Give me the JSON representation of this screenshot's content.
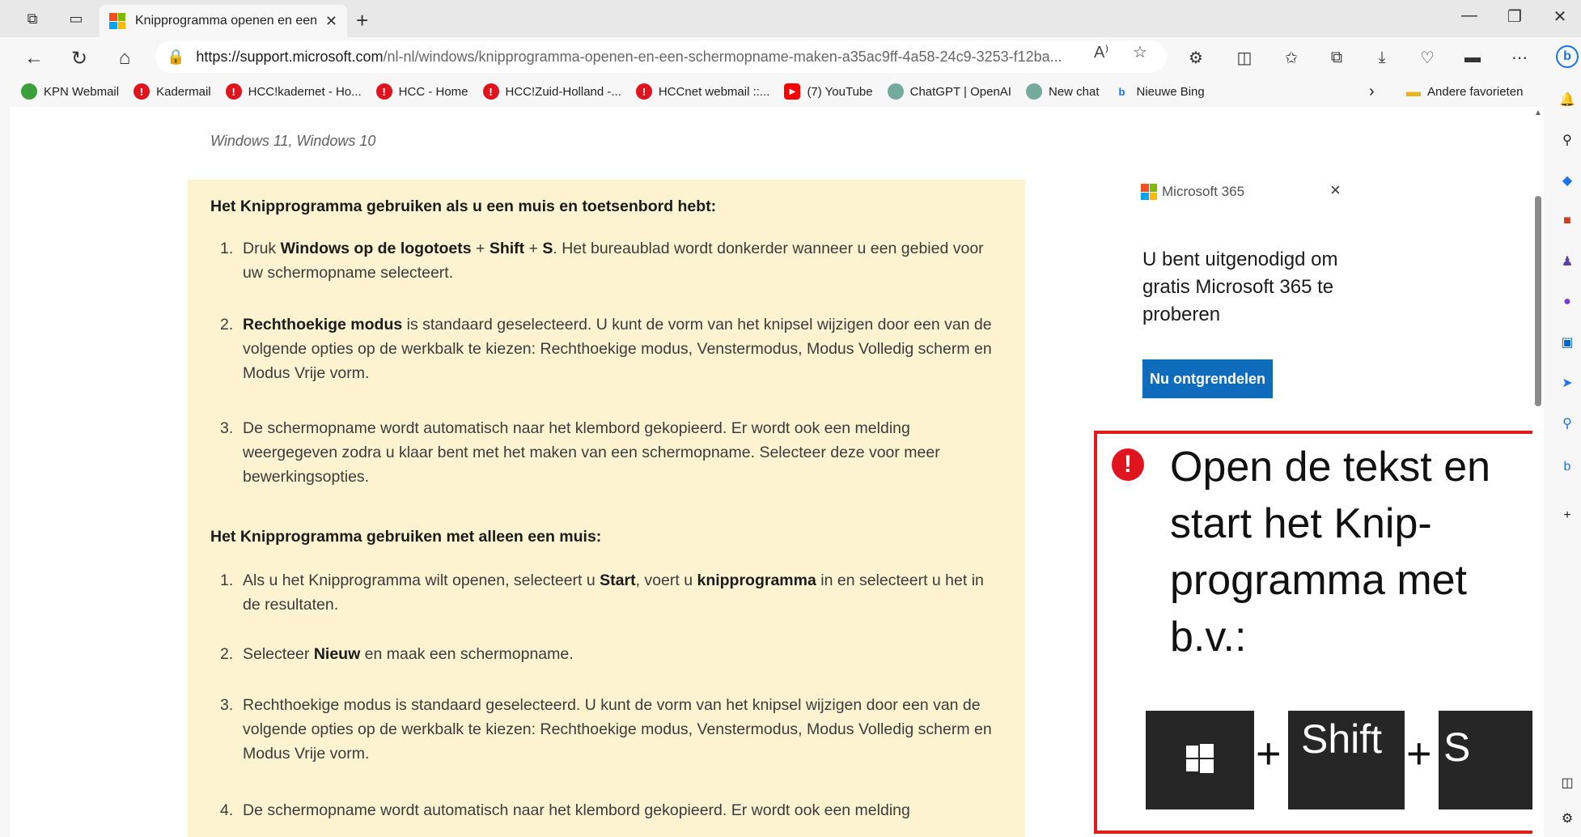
{
  "browser": {
    "tab_title": "Knipprogramma openen en een schermopname maken",
    "url_host": "https://support.microsoft.com",
    "url_rest": "/nl-nl/windows/knipprogramma-openen-en-een-schermopname-maken-a35ac9ff-4a58-24c9-3253-f12ba..."
  },
  "favorites": [
    {
      "label": "KPN Webmail",
      "icon": "kpn-icon",
      "color": "#3aa03a"
    },
    {
      "label": "Kadermail",
      "icon": "alert-icon",
      "color": "#e0141e"
    },
    {
      "label": "HCC!kadernet - Ho...",
      "icon": "alert-icon",
      "color": "#e0141e"
    },
    {
      "label": "HCC - Home",
      "icon": "alert-icon",
      "color": "#e0141e"
    },
    {
      "label": "HCC!Zuid-Holland -...",
      "icon": "alert-icon",
      "color": "#e0141e"
    },
    {
      "label": "HCCnet webmail ::...",
      "icon": "alert-icon",
      "color": "#e0141e"
    },
    {
      "label": "(7) YouTube",
      "icon": "youtube-icon",
      "color": "#ff0000"
    },
    {
      "label": "ChatGPT | OpenAI",
      "icon": "openai-icon",
      "color": "#74aa9c"
    },
    {
      "label": "New chat",
      "icon": "openai-icon",
      "color": "#74aa9c"
    },
    {
      "label": "Nieuwe Bing",
      "icon": "bing-icon",
      "color": "#1a73e8"
    }
  ],
  "other_favorites": "Andere favorieten",
  "article": {
    "applies_to": "Windows 11, Windows 10",
    "section1_heading": "Het Knipprogramma gebruiken als u een muis en toetsenbord hebt:",
    "section2_heading": "Het Knipprogramma gebruiken met alleen een muis:",
    "s1": [
      {
        "num": "1.",
        "parts": [
          "Druk ",
          "Windows op de logotoets",
          " + ",
          "Shift",
          " + ",
          "S",
          ". Het bureaublad wordt donkerder wanneer u een gebied voor uw schermopname selecteert."
        ]
      },
      {
        "num": "2.",
        "parts": [
          "Rechthoekige modus",
          " is standaard geselecteerd. U kunt de vorm van het knipsel wijzigen door een van de volgende opties op de werkbalk te kiezen: Rechthoekige modus, Venstermodus, Modus Volledig scherm en Modus Vrije vorm."
        ]
      },
      {
        "num": "3.",
        "text": "De schermopname wordt automatisch naar het klembord gekopieerd. Er wordt ook een melding weergegeven zodra u klaar bent met het maken van een schermopname. Selecteer deze voor meer bewerkingsopties."
      }
    ],
    "s2": [
      {
        "num": "1.",
        "parts": [
          "Als u het Knipprogramma wilt openen, selecteert u ",
          "Start",
          ", voert u ",
          "knipprogramma",
          " in en selecteert u het in de resultaten."
        ]
      },
      {
        "num": "2.",
        "parts": [
          "Selecteer ",
          "Nieuw",
          " en maak een schermopname."
        ]
      },
      {
        "num": "3.",
        "text": "Rechthoekige modus is standaard geselecteerd. U kunt de vorm van het knipsel wijzigen door een van de volgende opties op de werkbalk te kiezen: Rechthoekige modus, Venstermodus, Modus Volledig scherm en Modus Vrije vorm."
      },
      {
        "num": "4.",
        "text": "De schermopname wordt automatisch naar het klembord gekopieerd. Er wordt ook een melding"
      }
    ]
  },
  "ad": {
    "brand": "Microsoft 365",
    "text": "U bent uitgenodigd om gratis Microsoft 365 te proberen",
    "button": "Nu ontgrendelen",
    "close": "×"
  },
  "callout": {
    "text": "Open de tekst  en start het Knip-programma met b.v.:",
    "plus1": "+",
    "plus2": "+",
    "key_shift": "Shift",
    "key_s": "S"
  },
  "colors": {
    "note_bg": "#fdf3d1",
    "callout_border": "#e31b1b",
    "button_bg": "#0f6cbd"
  }
}
